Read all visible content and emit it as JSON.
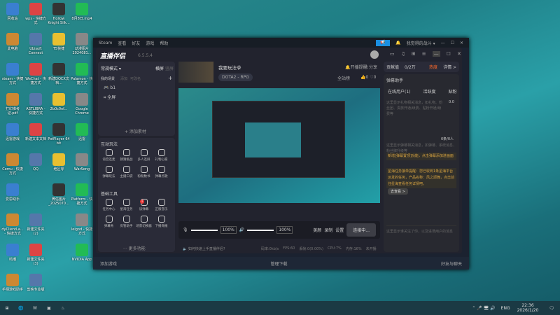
{
  "desktop_icons": [
    [
      "回收站",
      "wps - 快捷方式",
      "Hollow Knight Silk...",
      "8月8日.mp4",
      "此电脑",
      "Ubisoft Connect",
      "T5快捷",
      "动漫图片 2024081...",
      "steam - 快捷方式",
      "WeChat - 快捷方式",
      "新建DOCX文档...",
      "Palamon - 快捷方式",
      "打印准考证.pdf",
      "ASTLIBRA - 快捷方式",
      "2b0c0ef...",
      "Google Chrome",
      "迅雷游戏",
      "新建文本文档",
      "PotPlayer 64 bit",
      "迅雷",
      "Cemu - 快捷方式",
      "QQ",
      "绝区零",
      "WarSong",
      "爱思助手",
      "",
      "微信图片_2025070...",
      "Platform - 快捷方式",
      "dyClientLa... - 快捷方式",
      "新建文件夹 (2)",
      "",
      "leigod - 快捷方式",
      "鸣潮",
      "新建文件夹 (3)",
      "",
      "NVIDIA App",
      "手柄游戏助手",
      "剪映专业版",
      ""
    ]
  ],
  "steam": {
    "menu": [
      "Steam",
      "查看",
      "好友",
      "游戏",
      "帮助"
    ],
    "user": "我觉得的战斗 ▾",
    "add_game": "添加游戏",
    "manage_downloads": "管理下载",
    "friends_chat": "好友与聊天"
  },
  "app": {
    "title": "直播伴侣",
    "version": "6.5.5.4",
    "mode": "常规模式 ▾",
    "landscape": "横屏",
    "portrait": "竖屏",
    "scenes_label": "我的场景",
    "scene_add": "添加",
    "scene_rename": "可改名",
    "sources": [
      "b1",
      "全屏"
    ],
    "add_source": "+ 添加素材",
    "interactive_title": "互动玩法",
    "interactive": [
      "语音连麦",
      "猜猜挑战",
      "多人连屏",
      "礼物心愿",
      "弹幕玩法",
      "主播口袋",
      "粉粉数书",
      "弹幕点歌"
    ],
    "basic_title": "基础工具",
    "basic": [
      "任务中心",
      "星海任务",
      "读弹幕",
      "正版音乐",
      "弹幕秀",
      "房管助手",
      "场景切换器",
      "下播海报"
    ],
    "basic_badge": "1",
    "more": "··· 更多功能",
    "stream_title": "我要玩法爷",
    "category": "DOTA2 - RPG",
    "notify": "开播提醒",
    "share": "分享",
    "fan": "全站榜",
    "likes": "0",
    "hearts": "0",
    "mic": "麦克风",
    "mic_vol": "100%",
    "speaker": "扬声器",
    "speaker_vol": "100%",
    "beauty": "美颜",
    "record": "录制",
    "settings": "设置",
    "connect": "连接中...",
    "hint": "如何快速上手直播伴侣?",
    "stats": [
      "码率:0kb/s",
      "FPS:60",
      "丢帧:0(0.00%)",
      "CPU:7%",
      "内存:16%",
      "未开播"
    ],
    "contrib": "贡献值",
    "contrib_val": "0/2万",
    "hot": "热度",
    "detail": "详情 >",
    "danmu_title": "弹幕助手",
    "tabs": [
      "在线用户(1)",
      "活跃度",
      "贴粉"
    ],
    "gift_info": "这里显示礼物相关消息，如礼物、粉丝团、贵族开通/续费、贴粉开通/续费等",
    "gift_val": "0.0",
    "count": "0条/0人",
    "danmu_info": "这里显示弹幕相关消息，如弹幕、系统消息、粉丝牌升级等",
    "notice1": "新增[弹幕置顶]功能，点击弹幕添加进画面",
    "notice2": "星海任务接单提醒：您已收到1条星海平台派发的任务，产品名称：风之颂舞，点击前往星海查看任务详情吧。",
    "go_view": "去查看 >",
    "follow_info": "这里显示谁关注了你，以及进场用户的消息"
  },
  "taskbar": {
    "lang": "ENG",
    "time": "22:36",
    "date": "2026/1/20"
  },
  "colors": {
    "accent": "#2a7de1",
    "gold": "#d9a441",
    "hot": "#ff6a2a"
  }
}
